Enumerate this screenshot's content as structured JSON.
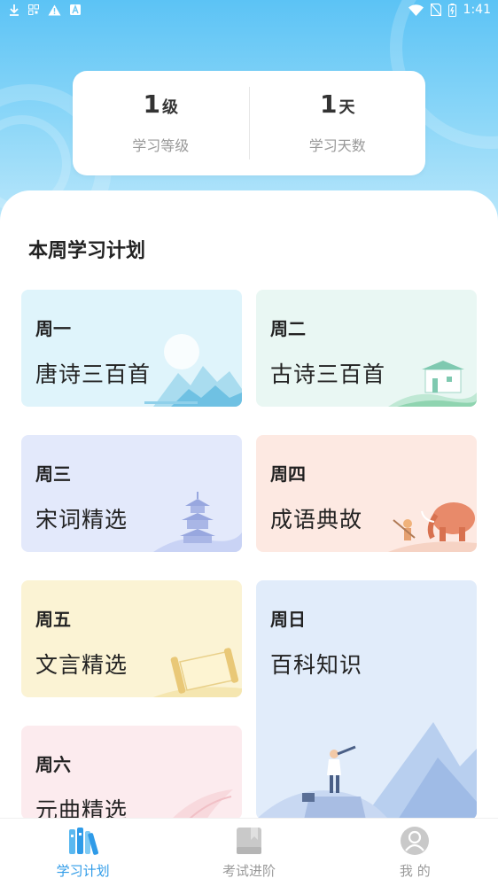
{
  "status_bar": {
    "time": "1:41",
    "left_icons": [
      "download-icon",
      "qr-icon",
      "warning-icon",
      "a-icon"
    ],
    "right_icons": [
      "wifi-icon",
      "no-sim-icon",
      "battery-icon"
    ]
  },
  "stats": {
    "level": {
      "value": "1",
      "unit": "级",
      "label": "学习等级"
    },
    "days": {
      "value": "1",
      "unit": "天",
      "label": "学习天数"
    }
  },
  "section": {
    "title": "本周学习计划"
  },
  "plan": [
    {
      "day": "周一",
      "topic": "唐诗三百首"
    },
    {
      "day": "周二",
      "topic": "古诗三百首"
    },
    {
      "day": "周三",
      "topic": "宋词精选"
    },
    {
      "day": "周四",
      "topic": "成语典故"
    },
    {
      "day": "周五",
      "topic": "文言精选"
    },
    {
      "day": "周日",
      "topic": "百科知识"
    },
    {
      "day": "周六",
      "topic": "元曲精选"
    }
  ],
  "tabbar": {
    "items": [
      {
        "label": "学习计划",
        "icon": "books-icon",
        "active": true
      },
      {
        "label": "考试进阶",
        "icon": "exam-book-icon",
        "active": false
      },
      {
        "label": "我 的",
        "icon": "profile-icon",
        "active": false
      }
    ]
  },
  "colors": {
    "accent": "#2f9be8",
    "hero_top": "#5cc3f5",
    "card_mon": "#dff4fb",
    "card_tue": "#e9f7f3",
    "card_wed": "#e3e9fb",
    "card_thu": "#fde9e2",
    "card_fri": "#fbf3d4",
    "card_sat": "#fcebee",
    "card_sun": "#e1ecfa"
  }
}
